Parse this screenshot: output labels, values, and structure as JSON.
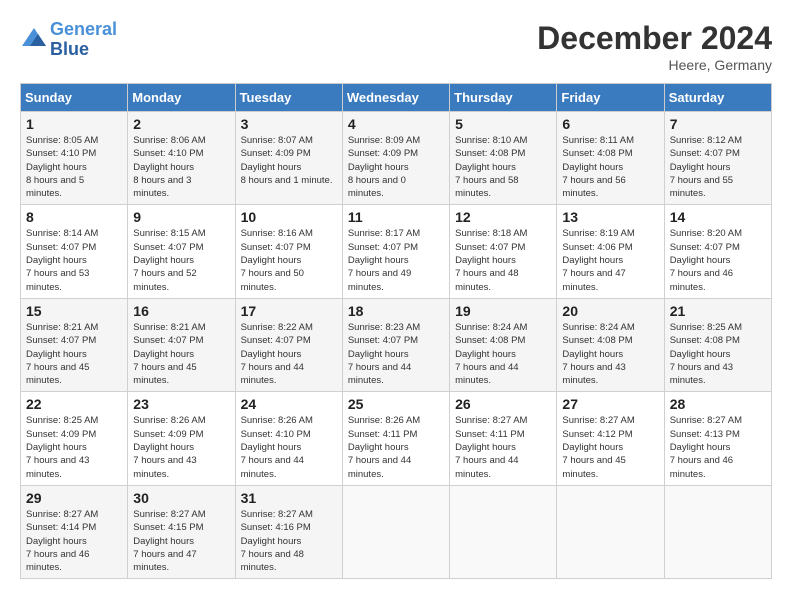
{
  "header": {
    "logo_line1": "General",
    "logo_line2": "Blue",
    "month": "December 2024",
    "location": "Heere, Germany"
  },
  "days_of_week": [
    "Sunday",
    "Monday",
    "Tuesday",
    "Wednesday",
    "Thursday",
    "Friday",
    "Saturday"
  ],
  "weeks": [
    [
      {
        "day": "1",
        "sunrise": "8:05 AM",
        "sunset": "4:10 PM",
        "daylight": "8 hours and 5 minutes."
      },
      {
        "day": "2",
        "sunrise": "8:06 AM",
        "sunset": "4:10 PM",
        "daylight": "8 hours and 3 minutes."
      },
      {
        "day": "3",
        "sunrise": "8:07 AM",
        "sunset": "4:09 PM",
        "daylight": "8 hours and 1 minute."
      },
      {
        "day": "4",
        "sunrise": "8:09 AM",
        "sunset": "4:09 PM",
        "daylight": "8 hours and 0 minutes."
      },
      {
        "day": "5",
        "sunrise": "8:10 AM",
        "sunset": "4:08 PM",
        "daylight": "7 hours and 58 minutes."
      },
      {
        "day": "6",
        "sunrise": "8:11 AM",
        "sunset": "4:08 PM",
        "daylight": "7 hours and 56 minutes."
      },
      {
        "day": "7",
        "sunrise": "8:12 AM",
        "sunset": "4:07 PM",
        "daylight": "7 hours and 55 minutes."
      }
    ],
    [
      {
        "day": "8",
        "sunrise": "8:14 AM",
        "sunset": "4:07 PM",
        "daylight": "7 hours and 53 minutes."
      },
      {
        "day": "9",
        "sunrise": "8:15 AM",
        "sunset": "4:07 PM",
        "daylight": "7 hours and 52 minutes."
      },
      {
        "day": "10",
        "sunrise": "8:16 AM",
        "sunset": "4:07 PM",
        "daylight": "7 hours and 50 minutes."
      },
      {
        "day": "11",
        "sunrise": "8:17 AM",
        "sunset": "4:07 PM",
        "daylight": "7 hours and 49 minutes."
      },
      {
        "day": "12",
        "sunrise": "8:18 AM",
        "sunset": "4:07 PM",
        "daylight": "7 hours and 48 minutes."
      },
      {
        "day": "13",
        "sunrise": "8:19 AM",
        "sunset": "4:06 PM",
        "daylight": "7 hours and 47 minutes."
      },
      {
        "day": "14",
        "sunrise": "8:20 AM",
        "sunset": "4:07 PM",
        "daylight": "7 hours and 46 minutes."
      }
    ],
    [
      {
        "day": "15",
        "sunrise": "8:21 AM",
        "sunset": "4:07 PM",
        "daylight": "7 hours and 45 minutes."
      },
      {
        "day": "16",
        "sunrise": "8:21 AM",
        "sunset": "4:07 PM",
        "daylight": "7 hours and 45 minutes."
      },
      {
        "day": "17",
        "sunrise": "8:22 AM",
        "sunset": "4:07 PM",
        "daylight": "7 hours and 44 minutes."
      },
      {
        "day": "18",
        "sunrise": "8:23 AM",
        "sunset": "4:07 PM",
        "daylight": "7 hours and 44 minutes."
      },
      {
        "day": "19",
        "sunrise": "8:24 AM",
        "sunset": "4:08 PM",
        "daylight": "7 hours and 44 minutes."
      },
      {
        "day": "20",
        "sunrise": "8:24 AM",
        "sunset": "4:08 PM",
        "daylight": "7 hours and 43 minutes."
      },
      {
        "day": "21",
        "sunrise": "8:25 AM",
        "sunset": "4:08 PM",
        "daylight": "7 hours and 43 minutes."
      }
    ],
    [
      {
        "day": "22",
        "sunrise": "8:25 AM",
        "sunset": "4:09 PM",
        "daylight": "7 hours and 43 minutes."
      },
      {
        "day": "23",
        "sunrise": "8:26 AM",
        "sunset": "4:09 PM",
        "daylight": "7 hours and 43 minutes."
      },
      {
        "day": "24",
        "sunrise": "8:26 AM",
        "sunset": "4:10 PM",
        "daylight": "7 hours and 44 minutes."
      },
      {
        "day": "25",
        "sunrise": "8:26 AM",
        "sunset": "4:11 PM",
        "daylight": "7 hours and 44 minutes."
      },
      {
        "day": "26",
        "sunrise": "8:27 AM",
        "sunset": "4:11 PM",
        "daylight": "7 hours and 44 minutes."
      },
      {
        "day": "27",
        "sunrise": "8:27 AM",
        "sunset": "4:12 PM",
        "daylight": "7 hours and 45 minutes."
      },
      {
        "day": "28",
        "sunrise": "8:27 AM",
        "sunset": "4:13 PM",
        "daylight": "7 hours and 46 minutes."
      }
    ],
    [
      {
        "day": "29",
        "sunrise": "8:27 AM",
        "sunset": "4:14 PM",
        "daylight": "7 hours and 46 minutes."
      },
      {
        "day": "30",
        "sunrise": "8:27 AM",
        "sunset": "4:15 PM",
        "daylight": "7 hours and 47 minutes."
      },
      {
        "day": "31",
        "sunrise": "8:27 AM",
        "sunset": "4:16 PM",
        "daylight": "7 hours and 48 minutes."
      },
      null,
      null,
      null,
      null
    ]
  ],
  "labels": {
    "sunrise": "Sunrise:",
    "sunset": "Sunset:",
    "daylight": "Daylight hours"
  }
}
